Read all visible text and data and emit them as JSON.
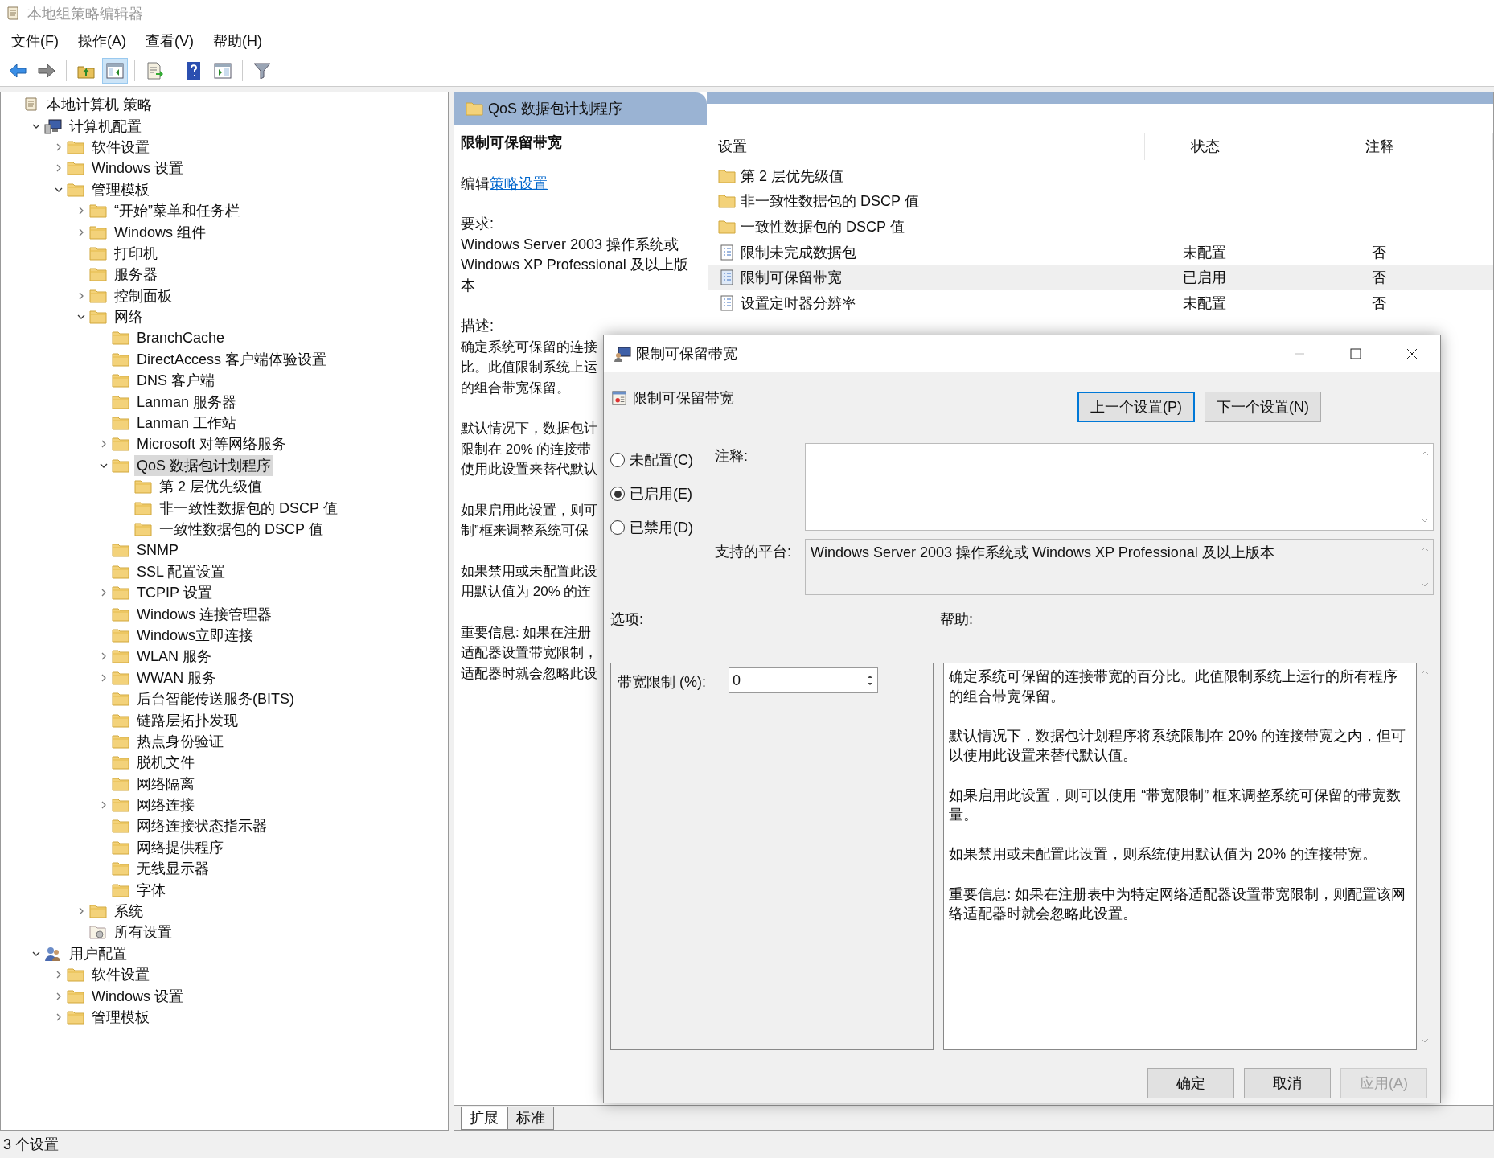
{
  "window": {
    "title": "本地组策略编辑器"
  },
  "menu": [
    "文件(F)",
    "操作(A)",
    "查看(V)",
    "帮助(H)"
  ],
  "toolbar": [
    {
      "pressed": false
    },
    {
      "pressed": false
    },
    {
      "pressed": false
    },
    {
      "pressed": true
    },
    {
      "pressed": false
    },
    {
      "pressed": false
    },
    {
      "pressed": false
    },
    {
      "pressed": false
    }
  ],
  "tree": [
    {
      "label": "本地计算机 策略",
      "kind": "policy",
      "selected": false,
      "children": [
        {
          "label": "计算机配置",
          "kind": "computer",
          "expanded": true,
          "selected": false,
          "children": [
            {
              "label": "软件设置",
              "kind": "folder",
              "expanded": false,
              "selected": false
            },
            {
              "label": "Windows 设置",
              "kind": "folder",
              "expanded": false,
              "selected": false
            },
            {
              "label": "管理模板",
              "kind": "folder",
              "expanded": true,
              "selected": false,
              "children": [
                {
                  "label": "“开始”菜单和任务栏",
                  "kind": "folder",
                  "expanded": false,
                  "selected": false
                },
                {
                  "label": "Windows 组件",
                  "kind": "folder",
                  "expanded": false,
                  "selected": false
                },
                {
                  "label": "打印机",
                  "kind": "folder",
                  "selected": false
                },
                {
                  "label": "服务器",
                  "kind": "folder",
                  "selected": false
                },
                {
                  "label": "控制面板",
                  "kind": "folder",
                  "expanded": false,
                  "selected": false
                },
                {
                  "label": "网络",
                  "kind": "folder",
                  "expanded": true,
                  "selected": false,
                  "children": [
                    {
                      "label": "BranchCache",
                      "kind": "folder",
                      "selected": false
                    },
                    {
                      "label": "DirectAccess 客户端体验设置",
                      "kind": "folder",
                      "selected": false
                    },
                    {
                      "label": "DNS 客户端",
                      "kind": "folder",
                      "selected": false
                    },
                    {
                      "label": "Lanman 服务器",
                      "kind": "folder",
                      "selected": false
                    },
                    {
                      "label": "Lanman 工作站",
                      "kind": "folder",
                      "selected": false
                    },
                    {
                      "label": "Microsoft 对等网络服务",
                      "kind": "folder",
                      "expanded": false,
                      "selected": false
                    },
                    {
                      "label": "QoS 数据包计划程序",
                      "kind": "folder",
                      "expanded": true,
                      "selected": true,
                      "children": [
                        {
                          "label": "第 2 层优先级值",
                          "kind": "folder",
                          "selected": false
                        },
                        {
                          "label": "非一致性数据包的 DSCP 值",
                          "kind": "folder",
                          "selected": false
                        },
                        {
                          "label": "一致性数据包的 DSCP 值",
                          "kind": "folder",
                          "selected": false
                        }
                      ]
                    },
                    {
                      "label": "SNMP",
                      "kind": "folder",
                      "selected": false
                    },
                    {
                      "label": "SSL 配置设置",
                      "kind": "folder",
                      "selected": false
                    },
                    {
                      "label": "TCPIP 设置",
                      "kind": "folder",
                      "expanded": false,
                      "selected": false
                    },
                    {
                      "label": "Windows 连接管理器",
                      "kind": "folder",
                      "selected": false
                    },
                    {
                      "label": "Windows立即连接",
                      "kind": "folder",
                      "selected": false
                    },
                    {
                      "label": "WLAN 服务",
                      "kind": "folder",
                      "expanded": false,
                      "selected": false
                    },
                    {
                      "label": "WWAN 服务",
                      "kind": "folder",
                      "expanded": false,
                      "selected": false
                    },
                    {
                      "label": "后台智能传送服务(BITS)",
                      "kind": "folder",
                      "selected": false
                    },
                    {
                      "label": "链路层拓扑发现",
                      "kind": "folder",
                      "selected": false
                    },
                    {
                      "label": "热点身份验证",
                      "kind": "folder",
                      "selected": false
                    },
                    {
                      "label": "脱机文件",
                      "kind": "folder",
                      "selected": false
                    },
                    {
                      "label": "网络隔离",
                      "kind": "folder",
                      "selected": false
                    },
                    {
                      "label": "网络连接",
                      "kind": "folder",
                      "expanded": false,
                      "selected": false
                    },
                    {
                      "label": "网络连接状态指示器",
                      "kind": "folder",
                      "selected": false
                    },
                    {
                      "label": "网络提供程序",
                      "kind": "folder",
                      "selected": false
                    },
                    {
                      "label": "无线显示器",
                      "kind": "folder",
                      "selected": false
                    },
                    {
                      "label": "字体",
                      "kind": "folder",
                      "selected": false
                    }
                  ]
                },
                {
                  "label": "系统",
                  "kind": "folder",
                  "expanded": false,
                  "selected": false
                },
                {
                  "label": "所有设置",
                  "kind": "settings",
                  "selected": false
                }
              ]
            }
          ]
        },
        {
          "label": "用户配置",
          "kind": "user",
          "expanded": true,
          "selected": false,
          "children": [
            {
              "label": "软件设置",
              "kind": "folder",
              "expanded": false,
              "selected": false
            },
            {
              "label": "Windows 设置",
              "kind": "folder",
              "expanded": false,
              "selected": false
            },
            {
              "label": "管理模板",
              "kind": "folder",
              "expanded": false,
              "selected": false
            }
          ]
        }
      ]
    }
  ],
  "pane": {
    "title": "QoS 数据包计划程序",
    "details": {
      "title": "限制可保留带宽",
      "edit_prefix": "编辑",
      "edit_link": "策略设置",
      "requirements_label": "要求:",
      "requirements": [
        "Windows Server 2003 操作系统或",
        "Windows XP Professional 及以上版",
        "本"
      ],
      "description_label": "描述:",
      "description": [
        [
          "确定系统可保留的连接",
          "比。此值限制系统上运",
          "的组合带宽保留。"
        ],
        [
          "默认情况下，数据包计",
          "限制在 20% 的连接带",
          "使用此设置来替代默认"
        ],
        [
          "如果启用此设置，则可",
          "制”框来调整系统可保"
        ],
        [
          "如果禁用或未配置此设",
          "用默认值为 20% 的连"
        ],
        [
          "重要信息: 如果在注册",
          "适配器设置带宽限制，",
          "适配器时就会忽略此设"
        ]
      ]
    },
    "columns": [
      "设置",
      "状态",
      "注释"
    ],
    "rows": [
      {
        "kind": "folder",
        "name": "第 2 层优先级值",
        "selected": false
      },
      {
        "kind": "folder",
        "name": "非一致性数据包的 DSCP 值",
        "selected": false
      },
      {
        "kind": "folder",
        "name": "一致性数据包的 DSCP 值",
        "selected": false
      },
      {
        "kind": "setting",
        "name": "限制未完成数据包",
        "status": "未配置",
        "comment": "否",
        "selected": false
      },
      {
        "kind": "setting",
        "name": "限制可保留带宽",
        "status": "已启用",
        "comment": "否",
        "selected": true
      },
      {
        "kind": "setting",
        "name": "设置定时器分辨率",
        "status": "未配置",
        "comment": "否",
        "selected": false
      }
    ],
    "tabs": [
      {
        "label": "扩展",
        "selected": true
      },
      {
        "label": "标准",
        "selected": false
      }
    ]
  },
  "status_bar": "3 个设置",
  "dialog": {
    "title": "限制可保留带宽",
    "setting_name": "限制可保留带宽",
    "prev_button": "上一个设置(P)",
    "next_button": "下一个设置(N)",
    "radios": [
      {
        "label": "未配置(C)",
        "selected": false
      },
      {
        "label": "已启用(E)",
        "selected": true
      },
      {
        "label": "已禁用(D)",
        "selected": false
      }
    ],
    "comment_label": "注释:",
    "platform_label": "支持的平台:",
    "platform": "Windows Server 2003 操作系统或 Windows XP Professional 及以上版本",
    "options_label": "选项:",
    "help_label": "帮助:",
    "option": {
      "label": "带宽限制 (%):",
      "value": "0"
    },
    "help": [
      "确定系统可保留的连接带宽的百分比。此值限制系统上运行的所有程序的组合带宽保留。",
      "默认情况下，数据包计划程序将系统限制在 20% 的连接带宽之内，但可以使用此设置来替代默认值。",
      "如果启用此设置，则可以使用 “带宽限制” 框来调整系统可保留的带宽数量。",
      "如果禁用或未配置此设置，则系统使用默认值为 20% 的连接带宽。",
      "重要信息: 如果在注册表中为特定网络适配器设置带宽限制，则配置该网络适配器时就会忽略此设置。"
    ],
    "buttons": [
      {
        "label": "确定",
        "disabled": false
      },
      {
        "label": "取消",
        "disabled": false
      },
      {
        "label": "应用(A)",
        "disabled": true
      }
    ]
  }
}
